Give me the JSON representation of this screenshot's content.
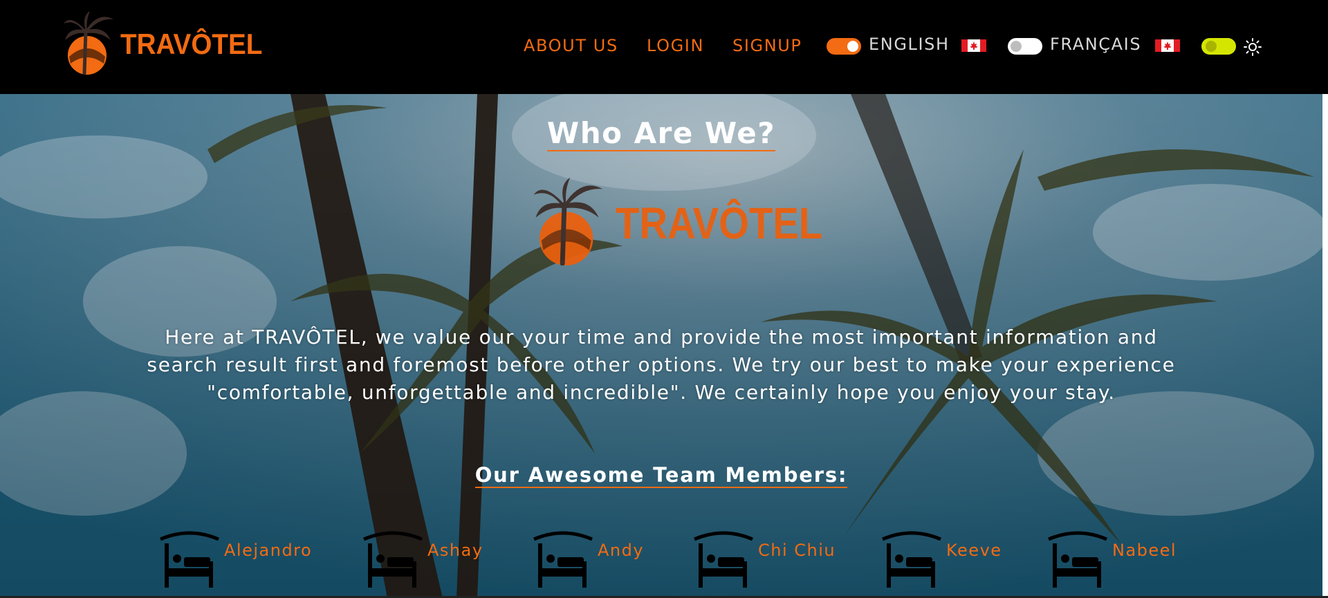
{
  "brand": {
    "name": "TRAVÔTEL",
    "accent_color": "#f36b12"
  },
  "nav": {
    "about_label": "ABOUT US",
    "login_label": "LOGIN",
    "signup_label": "SIGNUP"
  },
  "language": {
    "english_label": "ENGLISH",
    "english_enabled": true,
    "english_flag_icon": "canada-flag-icon",
    "french_label": "FRANÇAIS",
    "french_enabled": false,
    "french_flag_icon": "canada-flag-icon"
  },
  "theme": {
    "toggle_color": "#d4e600",
    "icon": "sun-icon"
  },
  "about": {
    "title": "Who Are We?",
    "intro": "Here at TRAVÔTEL, we value our your time and provide the most important information and search result first and foremost before other options. We try our best to make your experience \"comfortable, unforgettable and incredible\". We certainly hope you enjoy your stay.",
    "team_title": "Our Awesome Team Members:",
    "members": [
      {
        "name": "Alejandro",
        "icon": "bed-icon"
      },
      {
        "name": "Ashay",
        "icon": "bed-icon"
      },
      {
        "name": "Andy",
        "icon": "bed-icon"
      },
      {
        "name": "Chi Chiu",
        "icon": "bed-icon"
      },
      {
        "name": "Keeve",
        "icon": "bed-icon"
      },
      {
        "name": "Nabeel",
        "icon": "bed-icon"
      }
    ]
  }
}
